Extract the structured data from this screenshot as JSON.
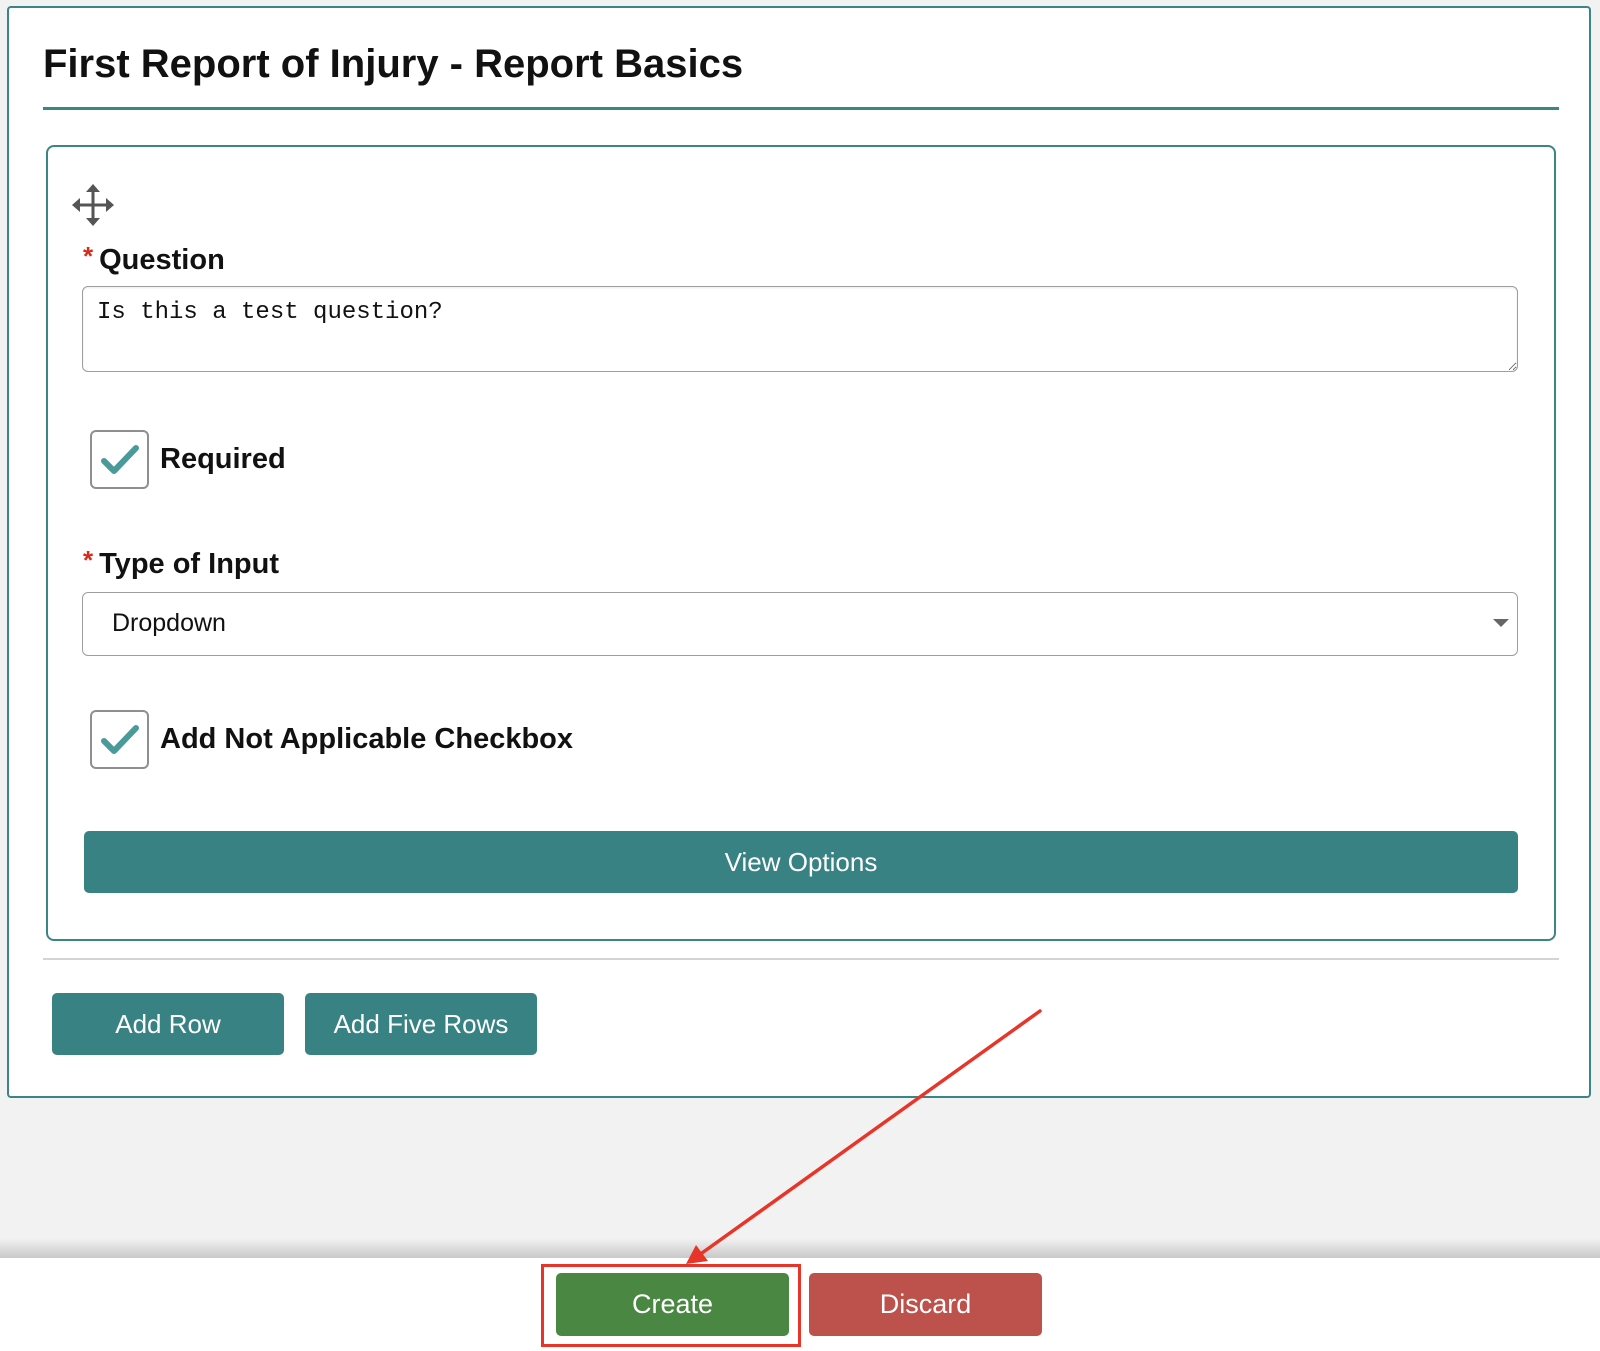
{
  "page": {
    "title": "First Report of Injury - Report Basics"
  },
  "question_card": {
    "question": {
      "required_marker": "*",
      "label": "Question",
      "value": "Is this a test question?"
    },
    "required_checkbox": {
      "label": "Required",
      "checked": true
    },
    "input_type": {
      "required_marker": "*",
      "label": "Type of Input",
      "selected": "Dropdown"
    },
    "not_applicable_checkbox": {
      "label": "Add Not Applicable Checkbox",
      "checked": true
    },
    "view_options_label": "View Options"
  },
  "row_actions": {
    "add_row_label": "Add Row",
    "add_five_rows_label": "Add Five Rows"
  },
  "footer": {
    "create_label": "Create",
    "discard_label": "Discard"
  },
  "icons": {
    "move": "move-icon",
    "check": "checkmark-icon",
    "caret": "chevron-down-icon"
  },
  "colors": {
    "teal": "#388284",
    "create_green": "#4a8743",
    "discard_red": "#bd514c",
    "annotation_red": "#e8352a",
    "required_star": "#d62a1d",
    "check_teal": "#4a9a9a"
  }
}
